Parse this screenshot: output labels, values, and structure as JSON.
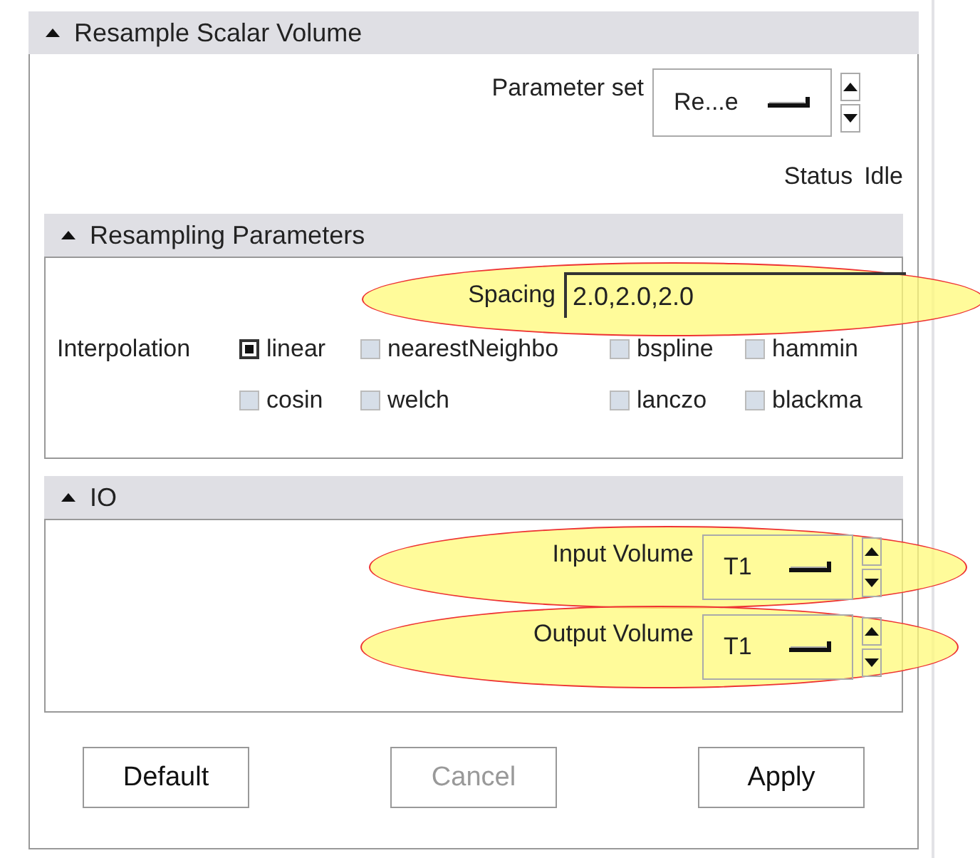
{
  "panel": {
    "title": "Resample Scalar Volume",
    "expanded": true
  },
  "parameter_set": {
    "label": "Parameter set",
    "value": "Re...e"
  },
  "status": {
    "label": "Status",
    "value": "Idle"
  },
  "resampling": {
    "title": "Resampling Parameters",
    "expanded": true,
    "spacing": {
      "label": "Spacing",
      "value": "2.0,2.0,2.0",
      "highlighted": true
    },
    "interpolation": {
      "label": "Interpolation",
      "options": [
        {
          "label": "linear",
          "checked": true
        },
        {
          "label": "nearestNeighbo",
          "checked": false
        },
        {
          "label": "bspline",
          "checked": false
        },
        {
          "label": "hammin",
          "checked": false
        },
        {
          "label": "cosin",
          "checked": false
        },
        {
          "label": "welch",
          "checked": false
        },
        {
          "label": "lanczo",
          "checked": false
        },
        {
          "label": "blackma",
          "checked": false
        }
      ]
    }
  },
  "io": {
    "title": "IO",
    "expanded": true,
    "fields": [
      {
        "label": "Input Volume",
        "value": "T1",
        "highlighted": true
      },
      {
        "label": "Output Volume",
        "value": "T1",
        "highlighted": true
      }
    ]
  },
  "buttons": [
    {
      "label": "Default",
      "disabled": false
    },
    {
      "label": "Cancel",
      "disabled": true
    },
    {
      "label": "Apply",
      "disabled": false
    }
  ]
}
